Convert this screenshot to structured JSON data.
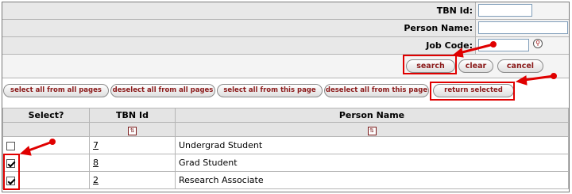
{
  "search": {
    "fields": [
      {
        "label": "TBN Id:",
        "value": "",
        "placeholder": ""
      },
      {
        "label": "Person Name:",
        "value": "",
        "placeholder": ""
      },
      {
        "label": "Job Code:",
        "value": "",
        "placeholder": ""
      }
    ],
    "lookup_icon": "lookup-magnifier-icon",
    "buttons": {
      "search": "search",
      "clear": "clear",
      "cancel": "cancel"
    }
  },
  "selection_buttons": {
    "select_all_pages": "select all from all pages",
    "deselect_all_pages": "deselect all from all pages",
    "select_all_page": "select all from this page",
    "deselect_all_page": "deselect all from this page",
    "return_selected": "return selected"
  },
  "table": {
    "columns": [
      "Select?",
      "TBN Id",
      "Person Name"
    ],
    "sort_icon": "sort-icon",
    "rows": [
      {
        "selected": false,
        "tbn_id": "7",
        "person_name": "Undergrad Student"
      },
      {
        "selected": true,
        "tbn_id": "8",
        "person_name": "Grad Student"
      },
      {
        "selected": true,
        "tbn_id": "2",
        "person_name": "Research Associate"
      }
    ]
  },
  "colors": {
    "annotation": "#e00000",
    "button_text": "#8b1a1a",
    "header_bg": "#e4e4e4"
  }
}
